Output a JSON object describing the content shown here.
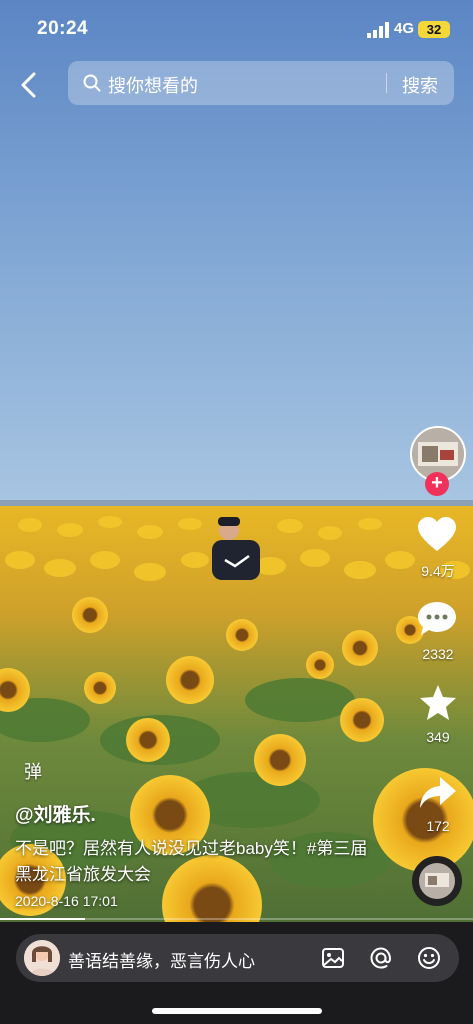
{
  "status_bar": {
    "time": "20:24",
    "network": "4G",
    "battery": "32"
  },
  "search": {
    "placeholder": "搜你想看的",
    "button_label": "搜索"
  },
  "rail": {
    "likes": "9.4万",
    "comments": "2332",
    "favorites": "349",
    "shares": "172",
    "follow": "+"
  },
  "overlay": {
    "danmu": "弹",
    "author": "@刘雅乐.",
    "caption": "不是吧？居然有人说没见过老baby笑！#第三届黑龙江省旅发大会",
    "date": "2020-8-16 17:01"
  },
  "playback": {
    "progress": 0.18
  },
  "comment_bar": {
    "placeholder": "善语结善缘，恶言伤人心"
  },
  "icons": [
    "back-icon",
    "search-icon",
    "heart-icon",
    "comment-icon",
    "star-icon",
    "share-icon",
    "image-icon",
    "at-icon",
    "emoji-icon"
  ],
  "colors": {
    "accent": "#f0325a",
    "battery": "#f4d83a"
  }
}
